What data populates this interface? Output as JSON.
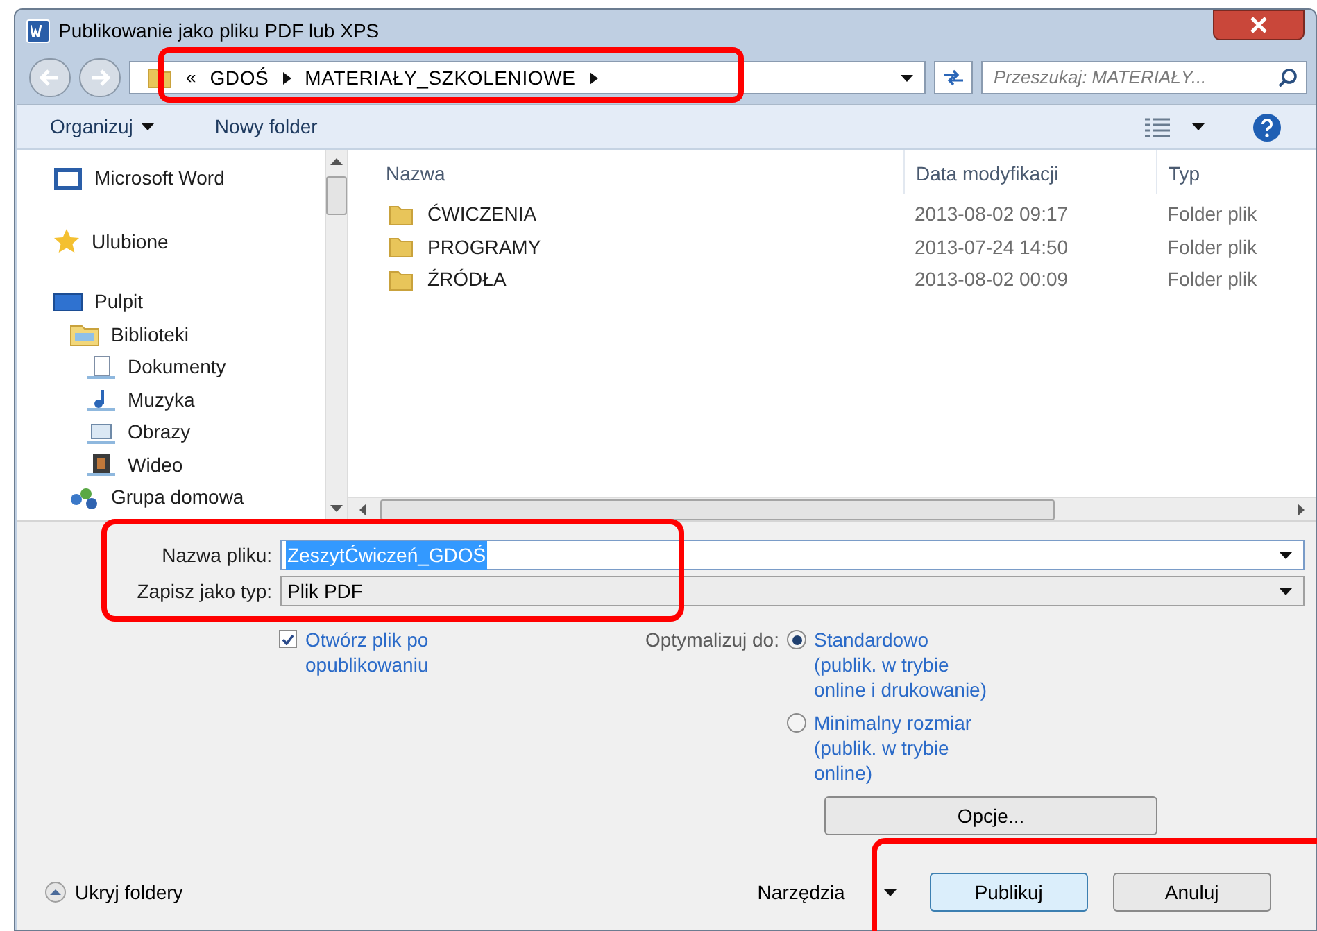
{
  "window": {
    "title": "Publikowanie jako pliku PDF lub XPS"
  },
  "address_bar": {
    "overflow": "«",
    "path": [
      "GDOŚ",
      "MATERIAŁY_SZKOLENIOWE"
    ]
  },
  "search": {
    "placeholder": "Przeszukaj: MATERIAŁY..."
  },
  "toolbar": {
    "organize": "Organizuj",
    "new_folder": "Nowy folder"
  },
  "sidebar": {
    "items": [
      {
        "kind": "word",
        "label": "Microsoft Word"
      },
      {
        "kind": "star",
        "label": "Ulubione"
      },
      {
        "kind": "desktop",
        "label": "Pulpit",
        "children": [
          {
            "kind": "library",
            "label": "Biblioteki",
            "children": [
              {
                "kind": "docs",
                "label": "Dokumenty"
              },
              {
                "kind": "music",
                "label": "Muzyka"
              },
              {
                "kind": "pictures",
                "label": "Obrazy"
              },
              {
                "kind": "video",
                "label": "Wideo"
              }
            ]
          },
          {
            "kind": "homegroup",
            "label": "Grupa domowa"
          }
        ]
      }
    ]
  },
  "file_list": {
    "columns": [
      "Nazwa",
      "Data modyfikacji",
      "Typ"
    ],
    "rows": [
      {
        "name": "ĆWICZENIA",
        "date": "2013-08-02 09:17",
        "type": "Folder plik"
      },
      {
        "name": "PROGRAMY",
        "date": "2013-07-24 14:50",
        "type": "Folder plik"
      },
      {
        "name": "ŹRÓDŁA",
        "date": "2013-08-02 00:09",
        "type": "Folder plik"
      }
    ]
  },
  "file_name": {
    "label": "Nazwa pliku:",
    "value": "ZeszytĆwiczeń_GDOŚ"
  },
  "save_type": {
    "label": "Zapisz jako typ:",
    "value": "Plik PDF"
  },
  "open_after": {
    "label": "Otwórz plik po opublikowaniu",
    "checked": true
  },
  "optimize": {
    "label": "Optymalizuj do:",
    "options": [
      {
        "label": "Standardowo (publik. w trybie online i drukowanie)",
        "selected": true
      },
      {
        "label": "Minimalny rozmiar (publik. w trybie online)",
        "selected": false
      }
    ]
  },
  "options_button": "Opcje...",
  "hide_folders": "Ukryj foldery",
  "tools": "Narzędzia",
  "buttons": [
    {
      "label": "Publikuj",
      "kind": "default"
    },
    {
      "label": "Anuluj",
      "kind": "normal"
    }
  ]
}
